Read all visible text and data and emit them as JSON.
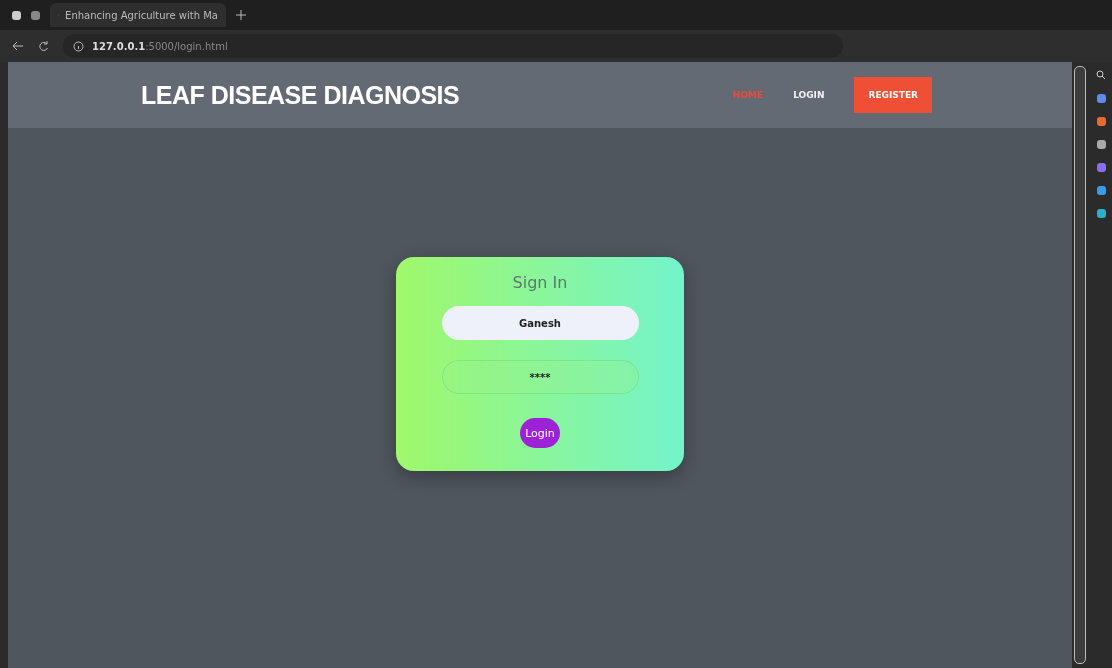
{
  "browser": {
    "tab_title": "Enhancing Agriculture with Ma",
    "address_host": "127.0.0.1",
    "address_path": ":5000/login.html"
  },
  "header": {
    "logo": "LEAF DISEASE DIAGNOSIS",
    "nav": [
      {
        "label": "HOME",
        "selected": true,
        "kind": "link"
      },
      {
        "label": "LOGIN",
        "selected": false,
        "kind": "link"
      },
      {
        "label": "REGISTER",
        "selected": false,
        "kind": "button"
      }
    ]
  },
  "form": {
    "title": "Sign In",
    "username": "Ganesh",
    "password": "****",
    "submit": "Login"
  }
}
